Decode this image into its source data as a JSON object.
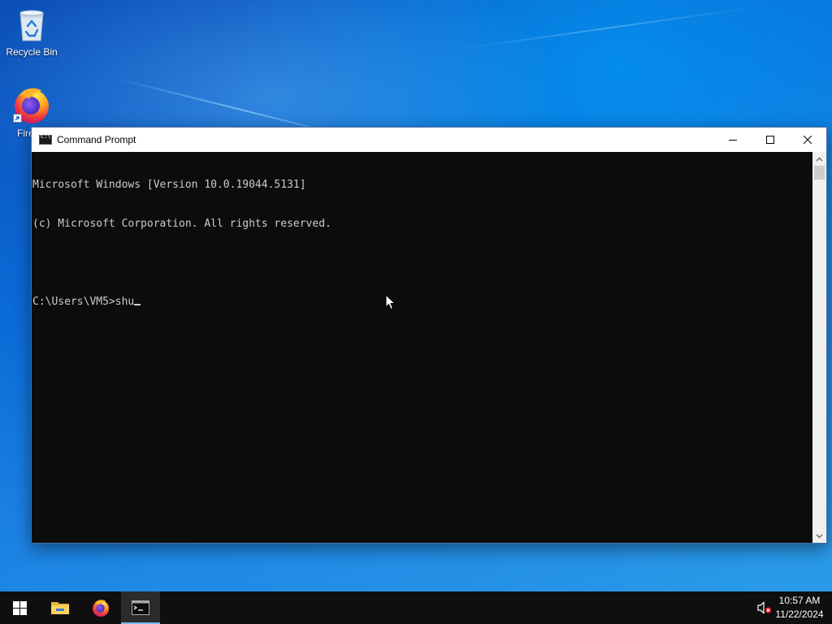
{
  "desktop": {
    "icons": [
      {
        "label": "Recycle Bin",
        "icon": "recycle-bin-icon"
      },
      {
        "label": "Fire",
        "icon": "firefox-icon"
      }
    ]
  },
  "window": {
    "title": "Command Prompt",
    "app_icon": "cmd-icon",
    "controls": {
      "minimize": "minimize-icon",
      "maximize": "maximize-icon",
      "close": "close-icon"
    },
    "console_lines": [
      "Microsoft Windows [Version 10.0.19044.5131]",
      "(c) Microsoft Corporation. All rights reserved.",
      "",
      "C:\\Users\\VM5>shu"
    ]
  },
  "taskbar": {
    "items": [
      {
        "name": "start",
        "icon": "windows-logo-icon"
      },
      {
        "name": "file-explorer",
        "icon": "folder-icon"
      },
      {
        "name": "firefox",
        "icon": "firefox-icon"
      },
      {
        "name": "command-prompt",
        "icon": "cmd-icon",
        "active": true
      }
    ],
    "tray": {
      "volume_icon": "volume-muted-icon",
      "time": "10:57 AM",
      "date": "11/22/2024"
    }
  },
  "colors": {
    "console_bg": "#0c0c0c",
    "console_fg": "#cccccc",
    "taskbar_bg": "#0f0f10",
    "taskbar_active_indicator": "#76b9ed"
  }
}
